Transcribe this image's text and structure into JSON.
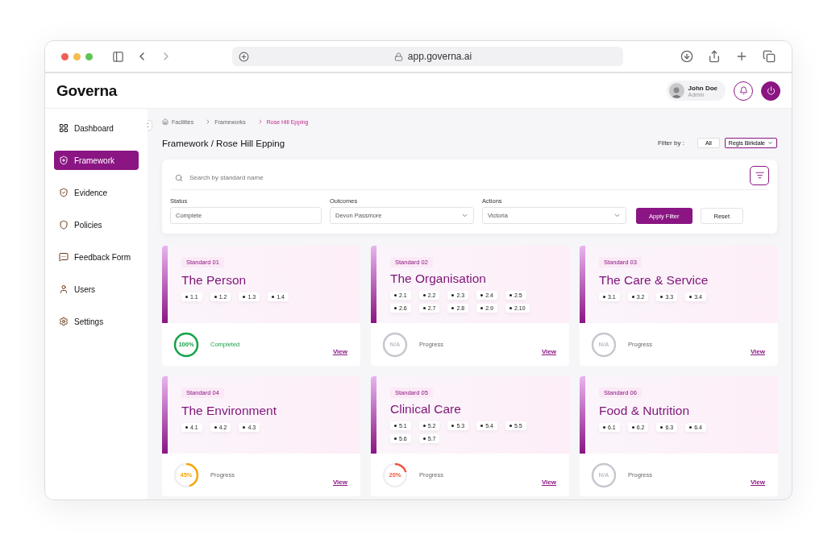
{
  "browser": {
    "url": "app.governa.ai"
  },
  "header": {
    "logo": "Governa",
    "user": {
      "name": "John Doe",
      "role": "Admin"
    }
  },
  "sidebar": {
    "items": [
      {
        "label": "Dashboard",
        "selected": false
      },
      {
        "label": "Framework",
        "selected": true
      },
      {
        "label": "Evidence",
        "selected": false
      },
      {
        "label": "Policies",
        "selected": false
      },
      {
        "label": "Feedback Form",
        "selected": false
      },
      {
        "label": "Users",
        "selected": false
      },
      {
        "label": "Settings",
        "selected": false
      }
    ]
  },
  "breadcrumb": [
    {
      "label": "Facilities",
      "selected": false
    },
    {
      "label": "Frameworks",
      "selected": false
    },
    {
      "label": "Rose Hill Epping",
      "selected": true
    }
  ],
  "page_title": "Framework / Rose Hill Epping",
  "filter_by": {
    "label": "Filter by :",
    "options": [
      {
        "label": "All",
        "selected": false
      },
      {
        "label": "Regis Birkdale",
        "selected": true
      }
    ]
  },
  "search": {
    "placeholder": "Search by standard name"
  },
  "filters": [
    {
      "label": "Status",
      "value": "Complete",
      "kind": "text"
    },
    {
      "label": "Outcomes",
      "value": "Devon Passmore",
      "kind": "select"
    },
    {
      "label": "Actions",
      "value": "Victoria",
      "kind": "select"
    }
  ],
  "buttons": {
    "apply": "Apply Filter",
    "reset": "Reset"
  },
  "standards": [
    {
      "tag": "Standard 01",
      "title": "The Person",
      "items": [
        "1.1",
        "1.2",
        "1.3",
        "1.4"
      ],
      "progress": {
        "label": "100%",
        "color": "#16a34a"
      },
      "status": "Completed",
      "link": "View"
    },
    {
      "tag": "Standard 02",
      "title": "The Organisation",
      "items": [
        "2.1",
        "2.2",
        "2.3",
        "2.4",
        "2.5",
        "2.6",
        "2.7",
        "2.8",
        "2.9",
        "2.10"
      ],
      "progress": {
        "label": "N/A",
        "color": "#c9c6cf"
      },
      "status": "Progress",
      "link": "View"
    },
    {
      "tag": "Standard 03",
      "title": "The Care & Service",
      "items": [
        "3.1",
        "3.2",
        "3.3",
        "3.4"
      ],
      "progress": {
        "label": "N/A",
        "color": "#c9c6cf"
      },
      "status": "Progress",
      "link": "View"
    },
    {
      "tag": "Standard 04",
      "title": "The Environment",
      "items": [
        "4.1",
        "4.2",
        "4.3"
      ],
      "progress": {
        "label": "45%",
        "color": "#f5a70a"
      },
      "status": "Progress",
      "link": "View"
    },
    {
      "tag": "Standard 05",
      "title": "Clinical Care",
      "items": [
        "5.1",
        "5.2",
        "5.3",
        "5.4",
        "5.5",
        "5.6",
        "5.7"
      ],
      "progress": {
        "label": "20%",
        "color": "#f0533a"
      },
      "status": "Progress",
      "link": "View"
    },
    {
      "tag": "Standard 06",
      "title": "Food & Nutrition",
      "items": [
        "6.1",
        "6.2",
        "6.3",
        "6.4"
      ],
      "progress": {
        "label": "N/A",
        "color": "#c9c6cf"
      },
      "status": "Progress",
      "link": "View"
    }
  ]
}
